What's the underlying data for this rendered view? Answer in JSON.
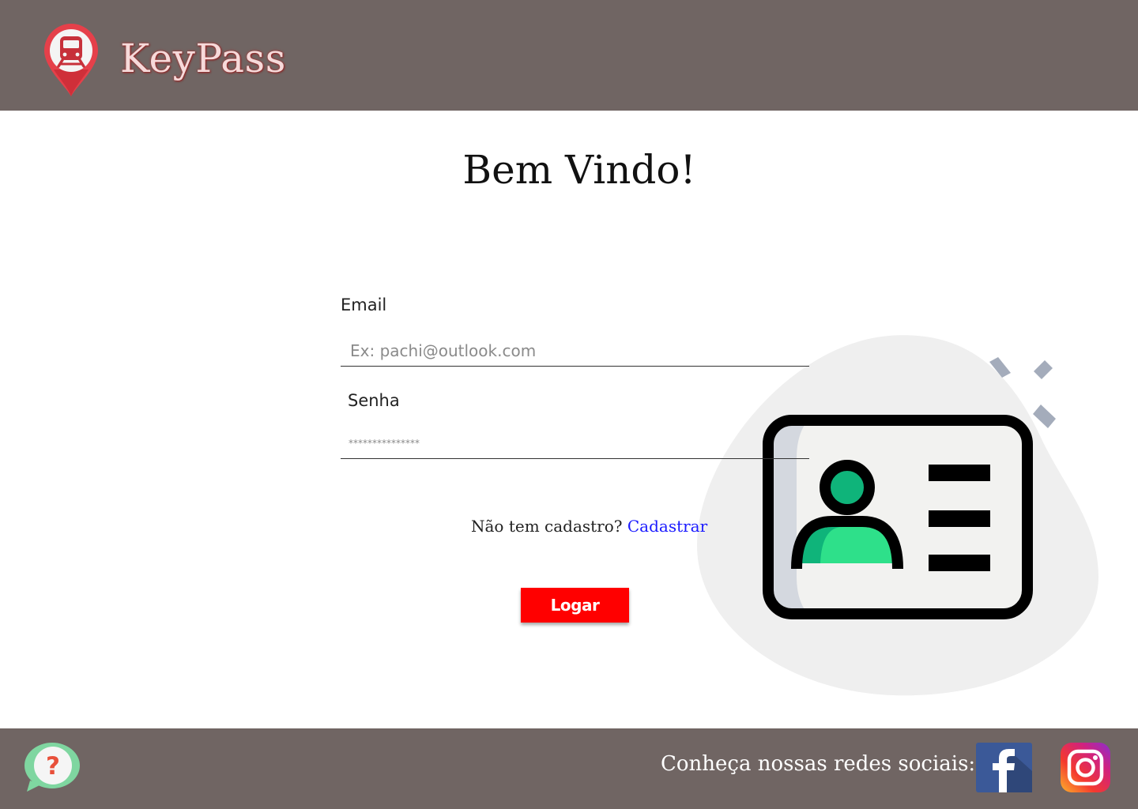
{
  "header": {
    "brand": "KeyPass",
    "logo_icon": "train-location-pin-icon"
  },
  "main": {
    "title": "Bem Vindo!",
    "email": {
      "label": "Email",
      "placeholder": "Ex: pachi@outlook.com",
      "value": ""
    },
    "password": {
      "label": "Senha",
      "placeholder": "***************",
      "value": ""
    },
    "signup": {
      "prompt": "Não tem cadastro? ",
      "link": "Cadastrar"
    },
    "login_button": "Logar",
    "illustration": "id-card-icon"
  },
  "footer": {
    "help_icon": "help-chat-icon",
    "social_text": "Conheça nossas redes sociais:",
    "facebook_icon": "facebook-icon",
    "instagram_icon": "instagram-icon"
  },
  "colors": {
    "header_footer_bg": "#706563",
    "brand_text": "#f6dada",
    "login_button": "#ff0000",
    "link": "#1a1aff",
    "blob": "#efefef",
    "card_accent": "#2ecf85"
  }
}
